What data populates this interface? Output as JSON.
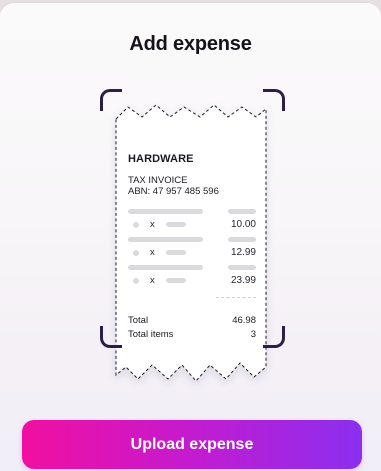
{
  "header": {
    "title": "Add expense"
  },
  "receipt": {
    "store": "HARDWARE",
    "invoice_label": "TAX INVOICE",
    "abn": "ABN: 47 957 485 596",
    "items": [
      {
        "qty_symbol": "x",
        "amount": "10.00"
      },
      {
        "qty_symbol": "x",
        "amount": "12.99"
      },
      {
        "qty_symbol": "x",
        "amount": "23.99"
      }
    ],
    "total_label": "Total",
    "total_value": "46.98",
    "total_items_label": "Total items",
    "total_items_value": "3"
  },
  "actions": {
    "upload_label": "Upload expense"
  },
  "colors": {
    "button_gradient_start": "#f10fa0",
    "button_gradient_end": "#8b2ff0",
    "scanner_corner": "#2c1f45"
  },
  "icons": [
    "scan-frame-icon"
  ]
}
